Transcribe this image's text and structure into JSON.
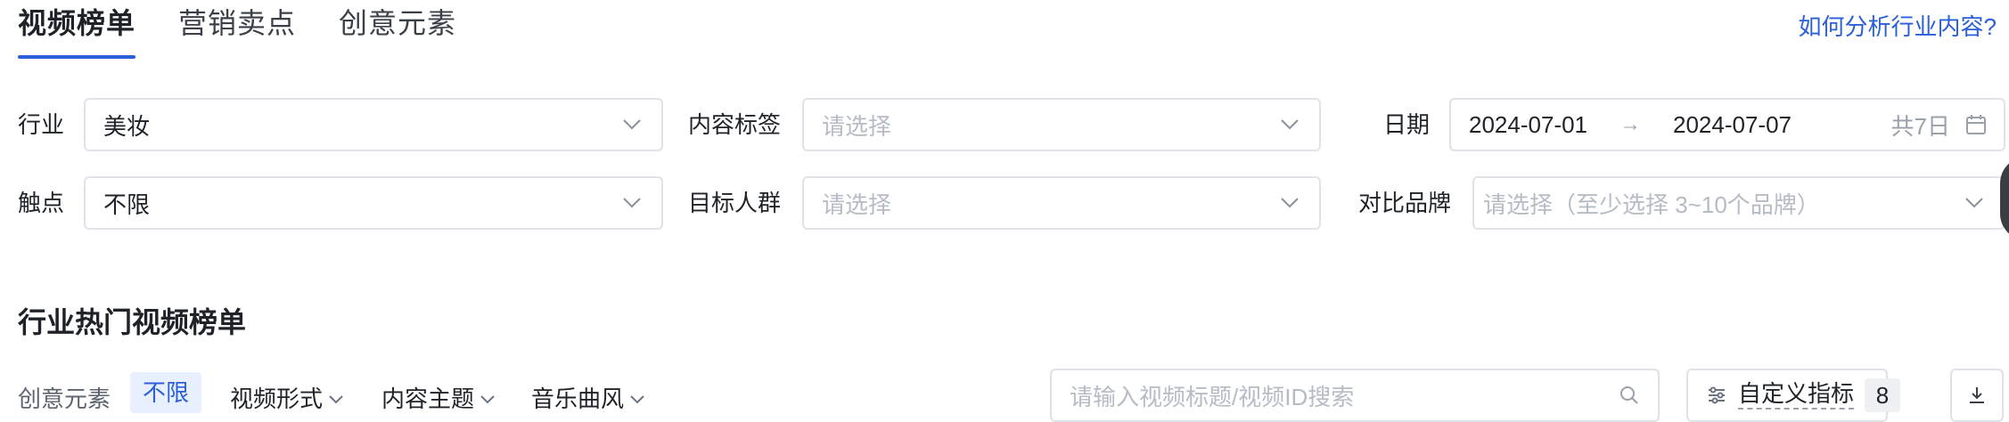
{
  "tabs": [
    {
      "label": "视频榜单",
      "active": true
    },
    {
      "label": "营销卖点",
      "active": false
    },
    {
      "label": "创意元素",
      "active": false
    }
  ],
  "help_link": "如何分析行业内容?",
  "filters": {
    "industry": {
      "label": "行业",
      "value": "美妆"
    },
    "content_tag": {
      "label": "内容标签",
      "placeholder": "请选择"
    },
    "date": {
      "label": "日期",
      "start": "2024-07-01",
      "end": "2024-07-07",
      "days": "共7日"
    },
    "touchpoint": {
      "label": "触点",
      "value": "不限"
    },
    "audience": {
      "label": "目标人群",
      "placeholder": "请选择"
    },
    "compare_brand": {
      "label": "对比品牌",
      "placeholder": "请选择（至少选择 3~10个品牌）"
    }
  },
  "section_title": "行业热门视频榜单",
  "toolbar": {
    "creative_label": "创意元素",
    "creative_chip": "不限",
    "dropdowns": [
      "视频形式",
      "内容主题",
      "音乐曲风"
    ],
    "search_placeholder": "请输入视频标题/视频ID搜索",
    "custom_metrics_label": "自定义指标",
    "custom_metrics_count": "8"
  },
  "icons": {
    "chevron": "chevron-down-icon",
    "calendar": "calendar-icon",
    "search": "search-icon",
    "settings": "sliders-icon",
    "download": "download-icon"
  },
  "colors": {
    "accent": "#2b5fd9",
    "chip_bg": "#e8efff",
    "border": "#dfe2e7",
    "placeholder": "#b6bcc6"
  }
}
